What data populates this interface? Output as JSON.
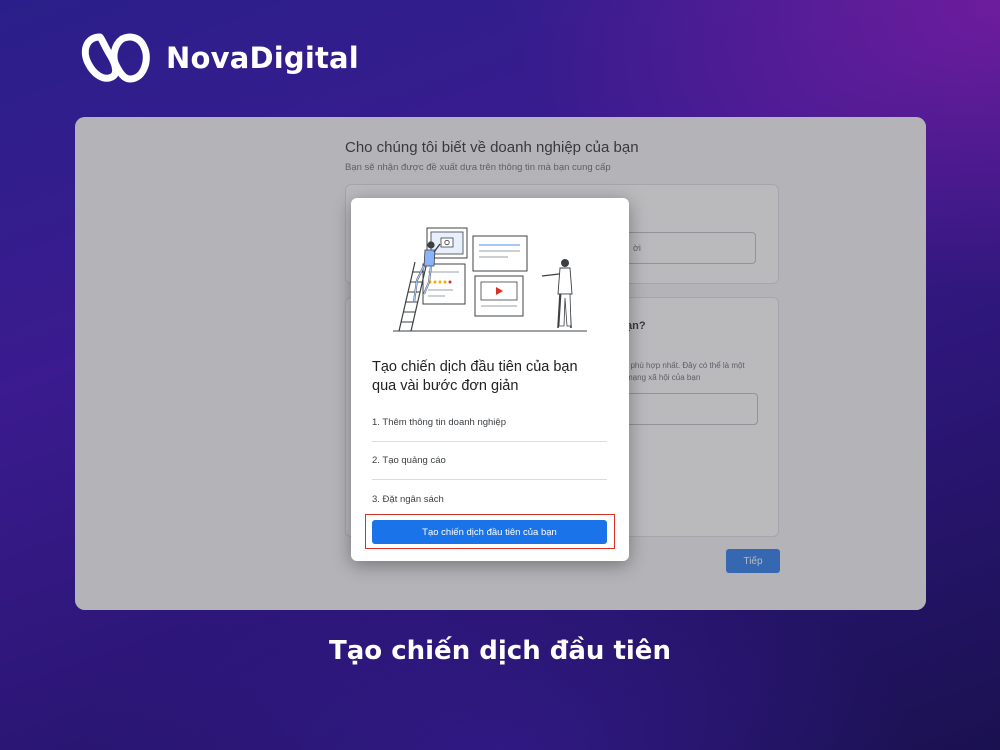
{
  "brand": {
    "name": "NovaDigital",
    "logo_icon": "brand-logo-icon"
  },
  "background_page": {
    "title": "Cho chúng tôi biết về doanh nghiệp của bạn",
    "subtitle": "Bạn sẽ nhận được đề xuất dựa trên thông tin mà bạn cung cấp",
    "card1_input_text": "ời",
    "card2_question": "ạn?",
    "card2_hint_line1": ", phù hợp nhất. Đây có thể là một",
    "card2_hint_line2": "mạng xã hội của bạn",
    "next_button": "Tiếp"
  },
  "modal": {
    "title_line1": "Tạo chiến dịch đầu tiên của bạn",
    "title_line2": "qua vài bước đơn giản",
    "steps": [
      "1. Thêm thông tin doanh nghiệp",
      "2. Tạo quảng cáo",
      "3. Đặt ngân sách"
    ],
    "cta_button": "Tạo chiến dịch đầu tiên của bạn",
    "accent_color": "#1a73e8",
    "highlight_color": "#d93025"
  },
  "caption": "Tạo chiến dịch đầu tiên"
}
